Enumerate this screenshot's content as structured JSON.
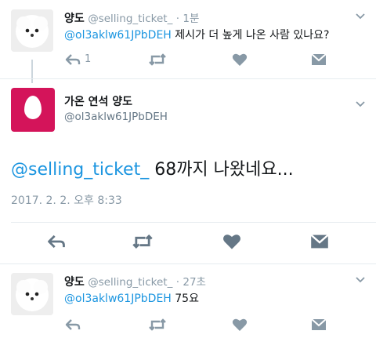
{
  "tweets": [
    {
      "name": "양도",
      "handle": "@selling_ticket_",
      "time": "· 1분",
      "mention": "@ol3aklw61JPbDEH",
      "text": " 제시가 더 높게 나온 사람 있나요?",
      "reply_count": "1",
      "avatar": "white-dog-avatar"
    },
    {
      "name": "가온 연석 양도",
      "handle": "@ol3aklw61JPbDEH",
      "mention": "@selling_ticket_",
      "text": " 68까지 나왔네요...",
      "timestamp": "2017. 2. 2. 오후 8:33",
      "avatar": "egg-avatar"
    },
    {
      "name": "양도",
      "handle": "@selling_ticket_",
      "time": "· 27초",
      "mention": "@ol3aklw61JPbDEH",
      "text": " 75요",
      "avatar": "white-dog-avatar"
    }
  ],
  "colors": {
    "icon_gray": "#8899a6",
    "icon_dark": "#657786",
    "mention_blue": "#1b95e0",
    "egg_bg": "#d4145a"
  }
}
